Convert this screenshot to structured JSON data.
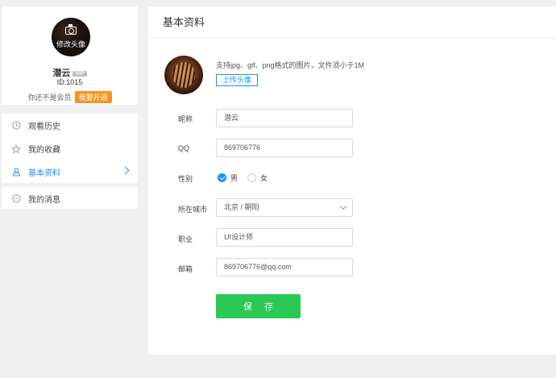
{
  "profile": {
    "avatar_edit_label": "修改头像",
    "username": "潜云",
    "vip_badge": "VIP",
    "user_id": "ID:1015",
    "membership_text": "你还不是会员",
    "open_membership_button": "我要开通"
  },
  "sidebar": {
    "items": [
      {
        "label": "观看历史",
        "icon": "clock-icon",
        "active": false
      },
      {
        "label": "我的收藏",
        "icon": "star-icon",
        "active": false
      },
      {
        "label": "基本资料",
        "icon": "user-icon",
        "active": true
      },
      {
        "label": "我的消息",
        "icon": "message-icon",
        "active": false
      }
    ]
  },
  "main": {
    "title": "基本资料",
    "avatar_hint": "支持jpg、gif、png格式的图片，文件须小于1M",
    "upload_button": "上传头像",
    "form": {
      "nickname_label": "昵称",
      "nickname_value": "潜云",
      "qq_label": "QQ",
      "qq_value": "869706776",
      "gender_label": "性别",
      "gender_options": [
        "男",
        "女"
      ],
      "gender_selected": "男",
      "city_label": "所在城市",
      "city_value": "北京 / 朝阳",
      "job_label": "职业",
      "job_value": "UI设计师",
      "email_label": "邮箱",
      "email_value": "869706776@qq.com"
    },
    "save_button": "保 存"
  },
  "colors": {
    "accent_blue": "#1890ff",
    "save_green": "#2ac955",
    "open_orange": "#f7941d"
  }
}
